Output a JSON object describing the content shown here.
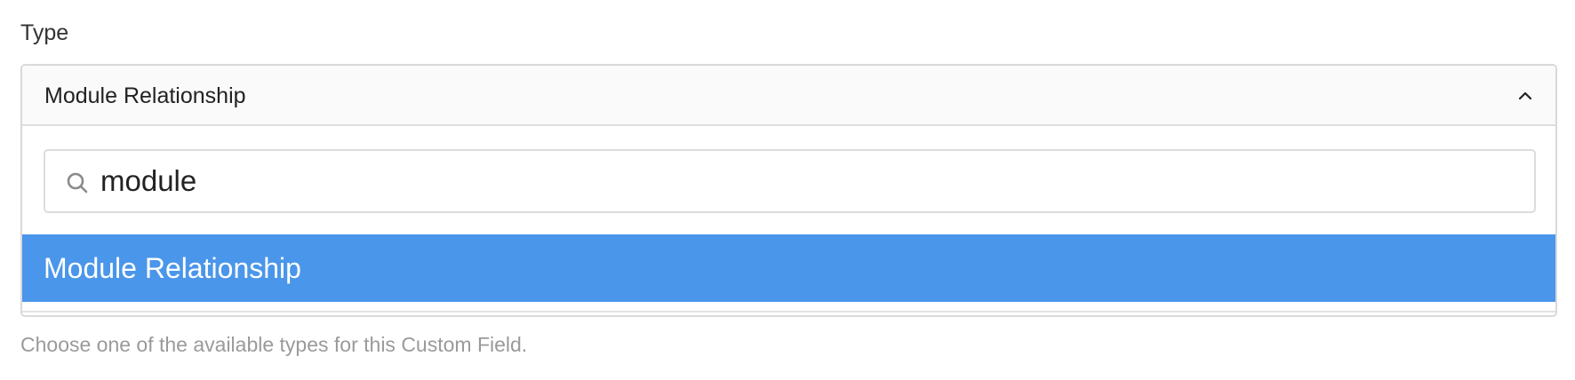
{
  "field": {
    "label": "Type",
    "selected_value": "Module Relationship",
    "help_text": "Choose one of the available types for this Custom Field."
  },
  "dropdown": {
    "expanded": true,
    "chevron_icon": "chevron-up-icon",
    "search": {
      "icon": "search-icon",
      "value": "module",
      "placeholder": ""
    },
    "options": [
      {
        "label": "Module Relationship",
        "highlighted": true
      }
    ]
  },
  "colors": {
    "highlight": "#4a96ea",
    "help_text": "#9a9a9a",
    "border": "#d9d9d9"
  }
}
